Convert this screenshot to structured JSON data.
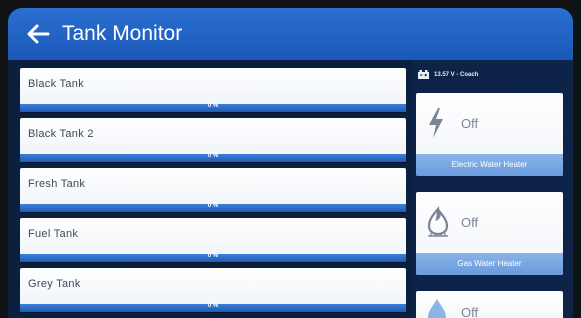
{
  "header": {
    "title": "Tank Monitor",
    "back_icon": "arrow-left-icon"
  },
  "tanks": [
    {
      "name": "Black Tank",
      "level_text": "0 %",
      "level": 0
    },
    {
      "name": "Black Tank 2",
      "level_text": "0 %",
      "level": 0
    },
    {
      "name": "Fresh Tank",
      "level_text": "0 %",
      "level": 0
    },
    {
      "name": "Fuel Tank",
      "level_text": "0 %",
      "level": 0
    },
    {
      "name": "Grey Tank",
      "level_text": "0 %",
      "level": 0
    }
  ],
  "battery": {
    "text": "13.57 V - Coach",
    "icon": "battery-icon"
  },
  "heaters": [
    {
      "state": "Off",
      "label": "Electric Water Heater",
      "icon": "lightning-icon"
    },
    {
      "state": "Off",
      "label": "Gas Water Heater",
      "icon": "flame-icon"
    },
    {
      "state": "Off",
      "label": "",
      "icon": "water-drop-icon"
    }
  ],
  "colors": {
    "header": "#1f5fc0",
    "background": "#0b1f3f",
    "bar": "#2a6ccb",
    "card_label": "#7aa7e2"
  }
}
